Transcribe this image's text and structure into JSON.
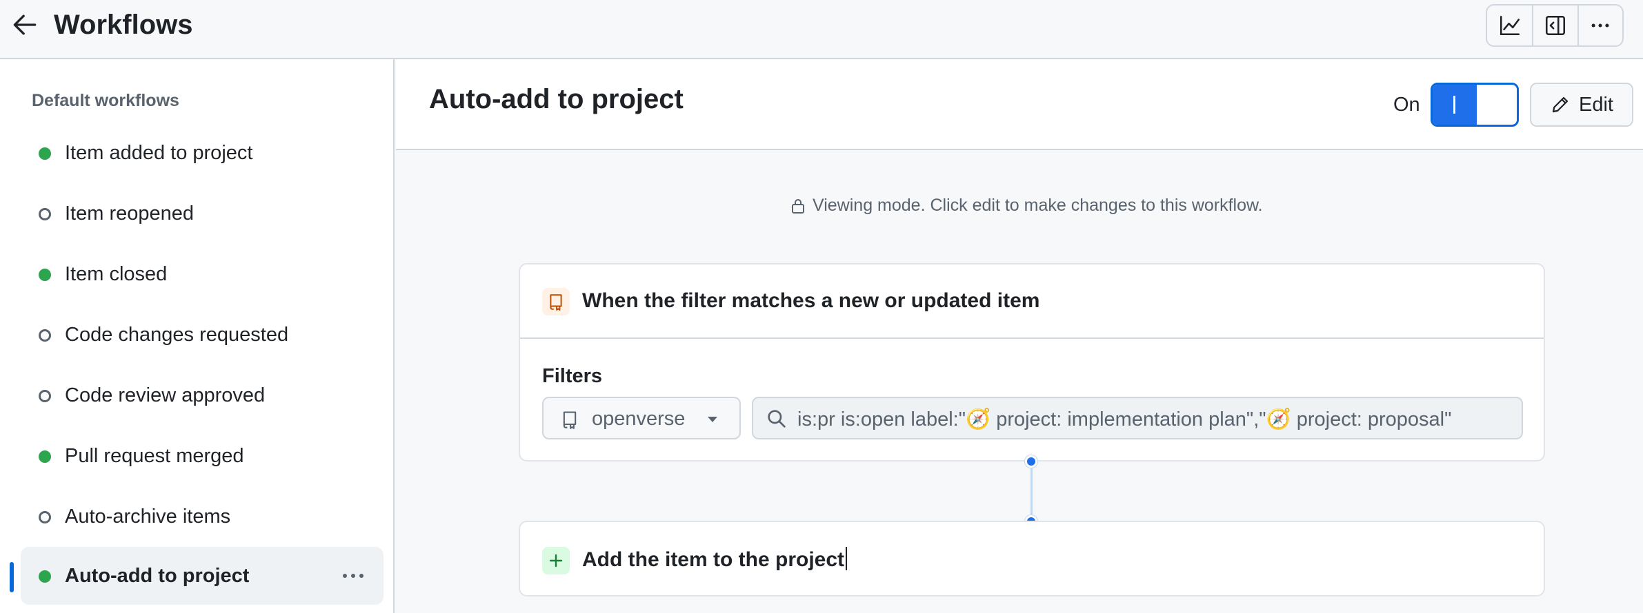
{
  "header": {
    "title": "Workflows",
    "back_icon": "arrow-left-icon",
    "tools": [
      "graph-icon",
      "sidebar-expand-icon",
      "kebab-horizontal-icon"
    ]
  },
  "sidebar": {
    "heading": "Default workflows",
    "items": [
      {
        "label": "Item added to project",
        "enabled": true
      },
      {
        "label": "Item reopened",
        "enabled": false
      },
      {
        "label": "Item closed",
        "enabled": true
      },
      {
        "label": "Code changes requested",
        "enabled": false
      },
      {
        "label": "Code review approved",
        "enabled": false
      },
      {
        "label": "Pull request merged",
        "enabled": true
      },
      {
        "label": "Auto-archive items",
        "enabled": false
      },
      {
        "label": "Auto-add to project",
        "enabled": true,
        "active": true
      }
    ]
  },
  "main": {
    "title": "Auto-add to project",
    "toggle_label": "On",
    "toggle_state": "on",
    "edit_label": "Edit",
    "viewing_note": "Viewing mode. Click edit to make changes to this workflow.",
    "trigger": {
      "title": "When the filter matches a new or updated item",
      "filters_label": "Filters",
      "repo": "openverse",
      "filter_query": "is:pr is:open label:\"🧭 project: implementation plan\",\"🧭 project: proposal\""
    },
    "action": {
      "title": "Add the item to the project"
    }
  },
  "colors": {
    "accent": "#0969da",
    "enabled_dot": "#2da44e",
    "border": "#d0d7de"
  }
}
